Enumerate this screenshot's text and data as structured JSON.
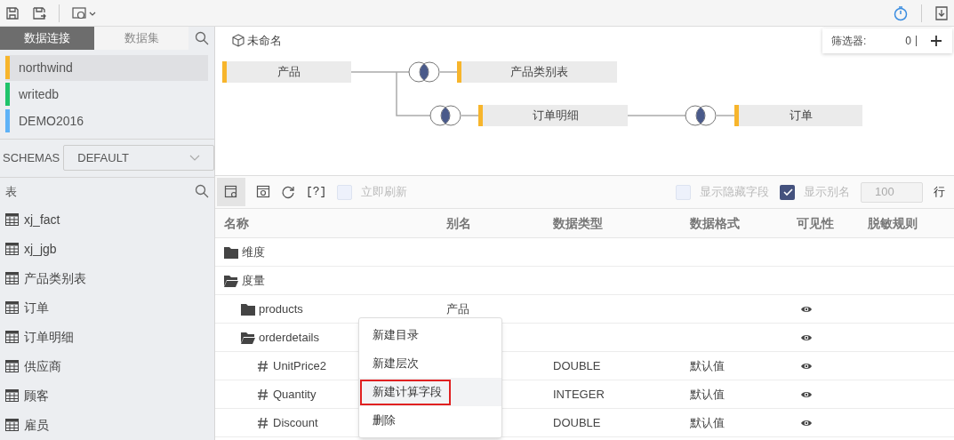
{
  "left_tabs": [
    {
      "label": "数据连接",
      "selected": true
    },
    {
      "label": "数据集",
      "selected": false
    }
  ],
  "connections": [
    {
      "name": "northwind",
      "color": "#f7b52c",
      "selected": true
    },
    {
      "name": "writedb",
      "color": "#1fc36a",
      "selected": false
    },
    {
      "name": "DEMO2016",
      "color": "#5eb2f7",
      "selected": false
    }
  ],
  "schemas": {
    "label": "SCHEMAS",
    "value": "DEFAULT"
  },
  "tables_panel": {
    "title": "表",
    "items": [
      "xj_fact",
      "xj_jgb",
      "产品类别表",
      "订单",
      "订单明细",
      "供应商",
      "顾客",
      "雇员"
    ]
  },
  "model": {
    "name": "未命名",
    "filter_label": "筛选器:",
    "filter_count": "0"
  },
  "diagram": {
    "nodes": [
      "产品",
      "产品类别表",
      "订单明细",
      "订单"
    ]
  },
  "toolbar": {
    "help": "[?]",
    "instant_refresh": {
      "label": "立即刷新",
      "checked": false
    },
    "show_hidden": {
      "label": "显示隐藏字段",
      "checked": false
    },
    "show_alias": {
      "label": "显示别名",
      "checked": true
    },
    "rows_value": "100",
    "rows_unit": "行"
  },
  "table": {
    "columns": [
      "名称",
      "别名",
      "数据类型",
      "数据格式",
      "可见性",
      "脱敏规则"
    ],
    "rows": [
      {
        "kind": "folder",
        "name": "维度",
        "expanded": false
      },
      {
        "kind": "folder",
        "name": "度量",
        "expanded": true,
        "children": [
          {
            "kind": "folder",
            "name": "products",
            "alias": "产品",
            "expanded": false,
            "visible": true
          },
          {
            "kind": "folder",
            "name": "orderdetails",
            "expanded": true,
            "visible": true,
            "children": [
              {
                "kind": "field",
                "name": "UnitPrice2",
                "type": "DOUBLE",
                "format": "默认值",
                "visible": true
              },
              {
                "kind": "field",
                "name": "Quantity",
                "type": "INTEGER",
                "format": "默认值",
                "visible": true
              },
              {
                "kind": "field",
                "name": "Discount",
                "type": "DOUBLE",
                "format": "默认值",
                "visible": true
              }
            ]
          }
        ]
      }
    ]
  },
  "context_menu": [
    {
      "label": "新建目录",
      "selected": false
    },
    {
      "label": "新建层次",
      "selected": false
    },
    {
      "label": "新建计算字段",
      "selected": true
    },
    {
      "label": "删除",
      "selected": false
    }
  ]
}
